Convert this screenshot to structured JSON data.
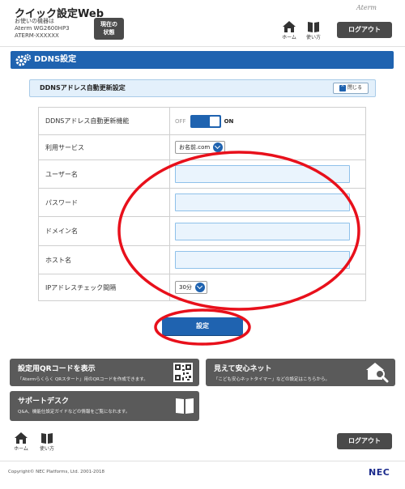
{
  "header": {
    "app_title": "クイック設定Web",
    "device_label": "お使いの機器は",
    "device_model": "Aterm WG2600HP3",
    "device_id": "ATERM-XXXXXX",
    "status_button_line1": "現在の",
    "status_button_line2": "状態",
    "brand": "Aterm",
    "home_label": "ホーム",
    "usage_label": "使い方",
    "logout_label": "ログアウト"
  },
  "page": {
    "title": "DDNS設定"
  },
  "section": {
    "title": "DDNSアドレス自動更新設定",
    "collapse_label": "閉じる"
  },
  "form": {
    "rows": [
      {
        "label": "DDNSアドレス自動更新機能",
        "off_label": "OFF",
        "on_label": "ON"
      },
      {
        "label": "利用サービス",
        "value": "お名前.com"
      },
      {
        "label": "ユーザー名",
        "value": ""
      },
      {
        "label": "パスワード",
        "value": ""
      },
      {
        "label": "ドメイン名",
        "value": ""
      },
      {
        "label": "ホスト名",
        "value": ""
      },
      {
        "label": "IPアドレスチェック間隔",
        "value": "30分"
      }
    ],
    "submit_label": "設定"
  },
  "tiles": {
    "qr_title": "設定用QRコードを表示",
    "qr_desc": "「Atermらくらく QRスタート」用のQRコードを作成できます。",
    "safety_title": "見えて安心ネット",
    "safety_desc": "「こども安心ネットタイマー」などの設定はこちらから。",
    "support_title": "サポートデスク",
    "support_desc": "Q&A、機能仕設定ガイドなどの情報をご覧になれます。"
  },
  "footer": {
    "home_label": "ホーム",
    "usage_label": "使い方",
    "logout_label": "ログアウト",
    "copyright": "Copyright© NEC Platforms, Ltd. 2001-2018",
    "nec_logo": "NEC"
  },
  "colors": {
    "primary_blue": "#1f63b0",
    "annotation_red": "#e8101b",
    "dark_button": "#4a4a4a",
    "tile_gray": "#5a5a5a"
  }
}
